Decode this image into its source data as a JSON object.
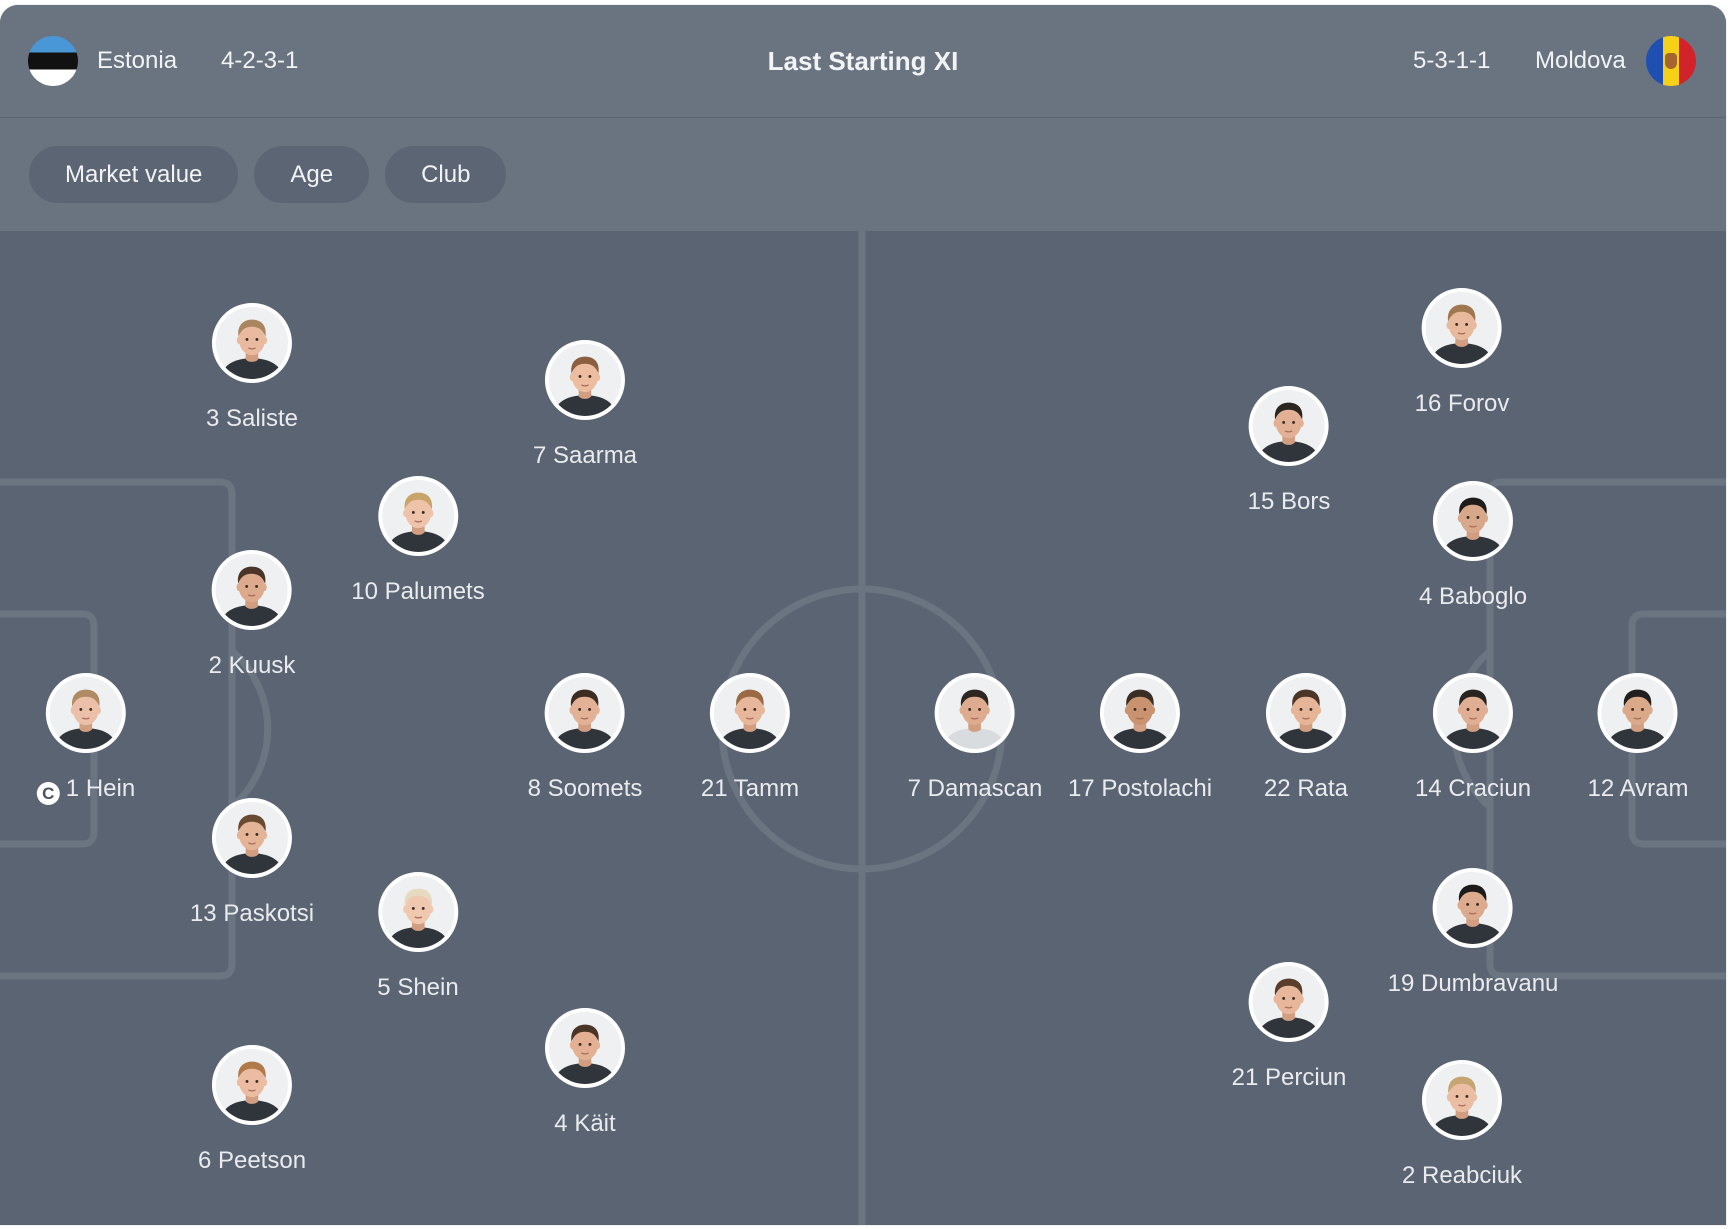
{
  "title": "Last Starting XI",
  "home": {
    "team": "Estonia",
    "formation": "4-2-3-1",
    "flag_icon": "estonia-flag-icon",
    "players": [
      {
        "number": 1,
        "name": "Hein",
        "captain": true
      },
      {
        "number": 3,
        "name": "Saliste"
      },
      {
        "number": 2,
        "name": "Kuusk"
      },
      {
        "number": 13,
        "name": "Paskotsi"
      },
      {
        "number": 6,
        "name": "Peetson"
      },
      {
        "number": 10,
        "name": "Palumets"
      },
      {
        "number": 5,
        "name": "Shein"
      },
      {
        "number": 7,
        "name": "Saarma"
      },
      {
        "number": 8,
        "name": "Soomets"
      },
      {
        "number": 4,
        "name": "Käit"
      },
      {
        "number": 21,
        "name": "Tamm"
      }
    ]
  },
  "away": {
    "team": "Moldova",
    "formation": "5-3-1-1",
    "flag_icon": "moldova-flag-icon",
    "players": [
      {
        "number": 12,
        "name": "Avram"
      },
      {
        "number": 16,
        "name": "Forov"
      },
      {
        "number": 4,
        "name": "Baboglo"
      },
      {
        "number": 14,
        "name": "Craciun"
      },
      {
        "number": 19,
        "name": "Dumbravanu"
      },
      {
        "number": 2,
        "name": "Reabciuk"
      },
      {
        "number": 15,
        "name": "Bors"
      },
      {
        "number": 22,
        "name": "Rata"
      },
      {
        "number": 21,
        "name": "Perciun"
      },
      {
        "number": 17,
        "name": "Postolachi"
      },
      {
        "number": 7,
        "name": "Damascan"
      }
    ]
  },
  "filters": [
    {
      "label": "Market value"
    },
    {
      "label": "Age"
    },
    {
      "label": "Club"
    }
  ],
  "captain_mark": "C",
  "colors": {
    "header_bg": "#6a7481",
    "pitch_bg": "#5b6472",
    "pitch_lines": "#6b7481",
    "pill_bg": "#5c6573",
    "text": "#f1f3f5",
    "name_text": "#e9ebee"
  }
}
